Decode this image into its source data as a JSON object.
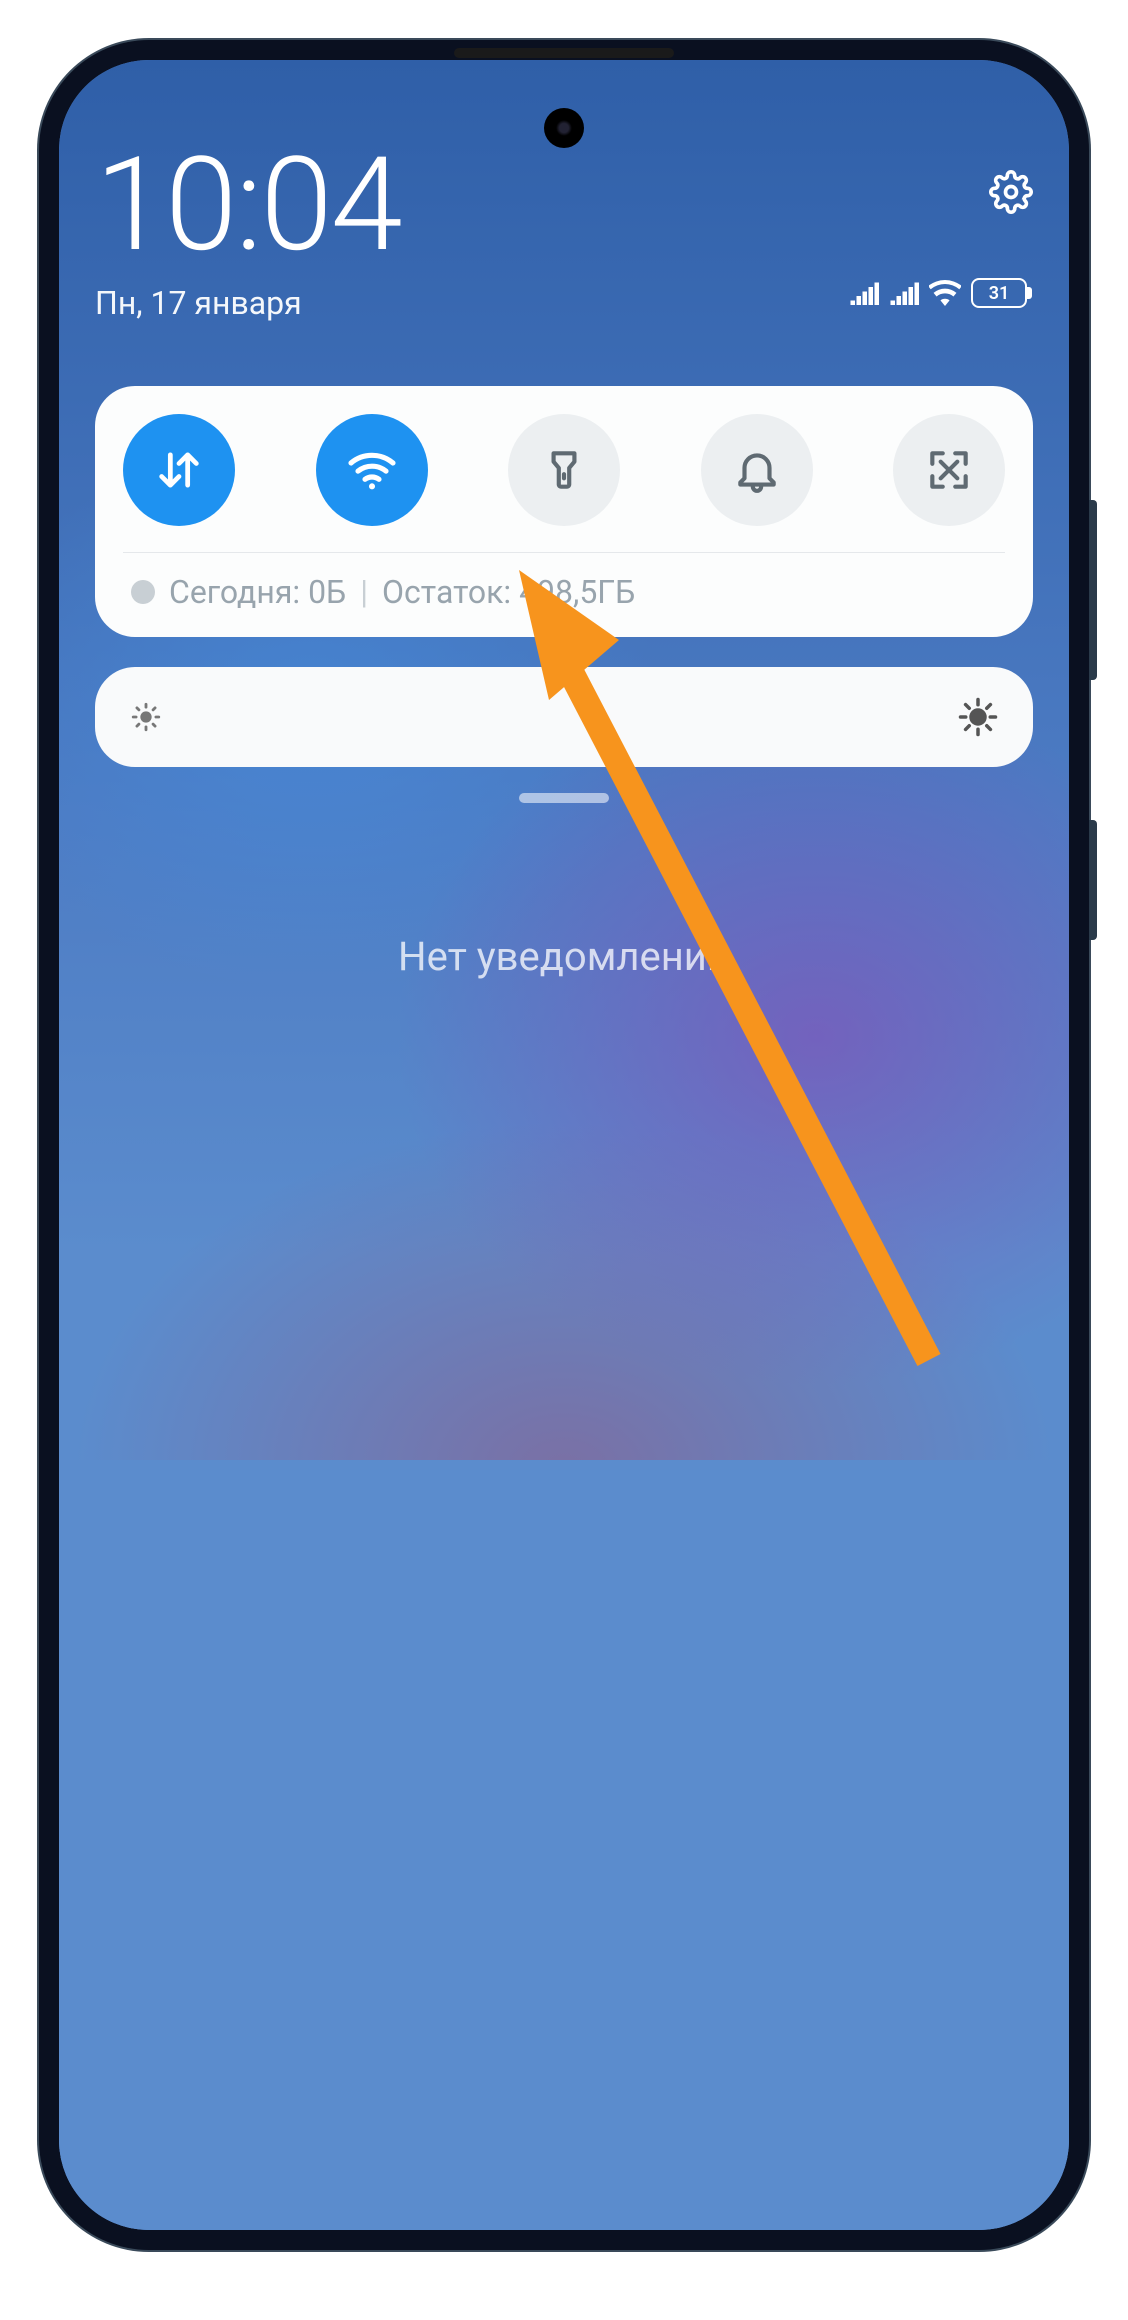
{
  "status": {
    "time": "10:04",
    "date": "Пн, 17 января",
    "battery_percent": "31"
  },
  "quick_settings": {
    "toggles": [
      {
        "name": "mobile-data",
        "on": true
      },
      {
        "name": "wifi",
        "on": true
      },
      {
        "name": "flashlight",
        "on": false
      },
      {
        "name": "do-not-disturb",
        "on": false
      },
      {
        "name": "screenshot",
        "on": false
      }
    ],
    "data_usage": {
      "today_label": "Сегодня: 0Б",
      "remaining_label": "Остаток: 498,5ГБ"
    }
  },
  "notifications": {
    "empty_text": "Нет уведомлений"
  },
  "annotation": {
    "arrow_target": "data-usage-remaining"
  }
}
